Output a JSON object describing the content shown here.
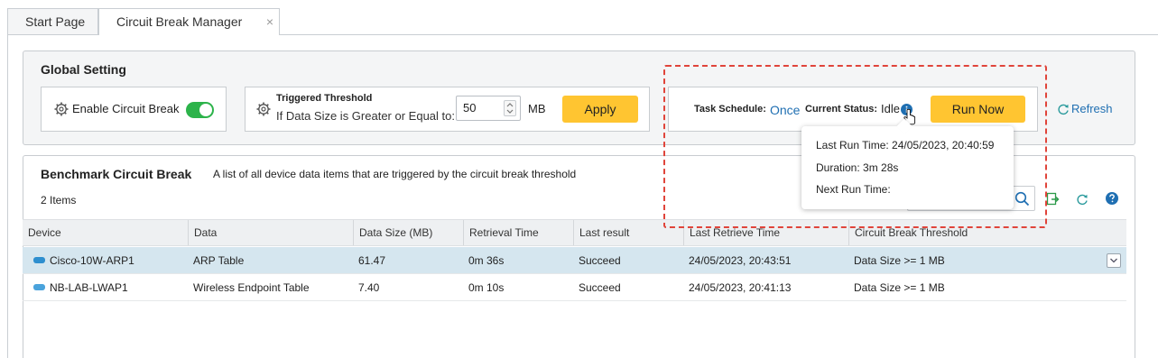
{
  "tabs": [
    {
      "label": "Start Page"
    },
    {
      "label": "Circuit Break Manager"
    }
  ],
  "tab_close_glyph": "×",
  "global": {
    "title": "Global Setting",
    "enable_label": "Enable Circuit Break",
    "enable_on": true,
    "threshold_title": "Triggered Threshold",
    "threshold_desc": "If Data Size is Greater or Equal to:",
    "threshold_value": "50",
    "threshold_unit": "MB",
    "apply_label": "Apply",
    "task_schedule_label": "Task Schedule:",
    "task_schedule_value": "Once",
    "status_label": "Current Status:",
    "status_value": "Idle",
    "run_now_label": "Run Now",
    "refresh_label": "Refresh"
  },
  "tooltip": {
    "last_run": "Last Run Time: 24/05/2023, 20:40:59",
    "duration": "Duration: 3m 28s",
    "next_run": "Next Run Time:"
  },
  "benchmark": {
    "title": "Benchmark Circuit Break",
    "description": "A list of all device data items that are triggered by the circuit break threshold",
    "count": "2 Items",
    "columns": [
      "Device",
      "Data",
      "Data Size (MB)",
      "Retrieval Time",
      "Last result",
      "Last Retrieve Time",
      "Circuit Break Threshold"
    ],
    "rows": [
      {
        "device": "Cisco-10W-ARP1",
        "data": "ARP Table",
        "size": "61.47",
        "retrieval": "0m 36s",
        "result": "Succeed",
        "last_time": "24/05/2023, 20:43:51",
        "threshold": "Data Size >= 1 MB"
      },
      {
        "device": "NB-LAB-LWAP1",
        "data": "Wireless Endpoint Table",
        "size": "7.40",
        "retrieval": "0m 10s",
        "result": "Succeed",
        "last_time": "24/05/2023, 20:41:13",
        "threshold": "Data Size >= 1 MB"
      }
    ]
  },
  "colors": {
    "accent_yellow": "#ffc531",
    "toggle_green": "#2cb34a",
    "link_blue": "#1f6fb2",
    "highlight_red": "#e0443a",
    "selected_row": "#d5e6ef"
  }
}
